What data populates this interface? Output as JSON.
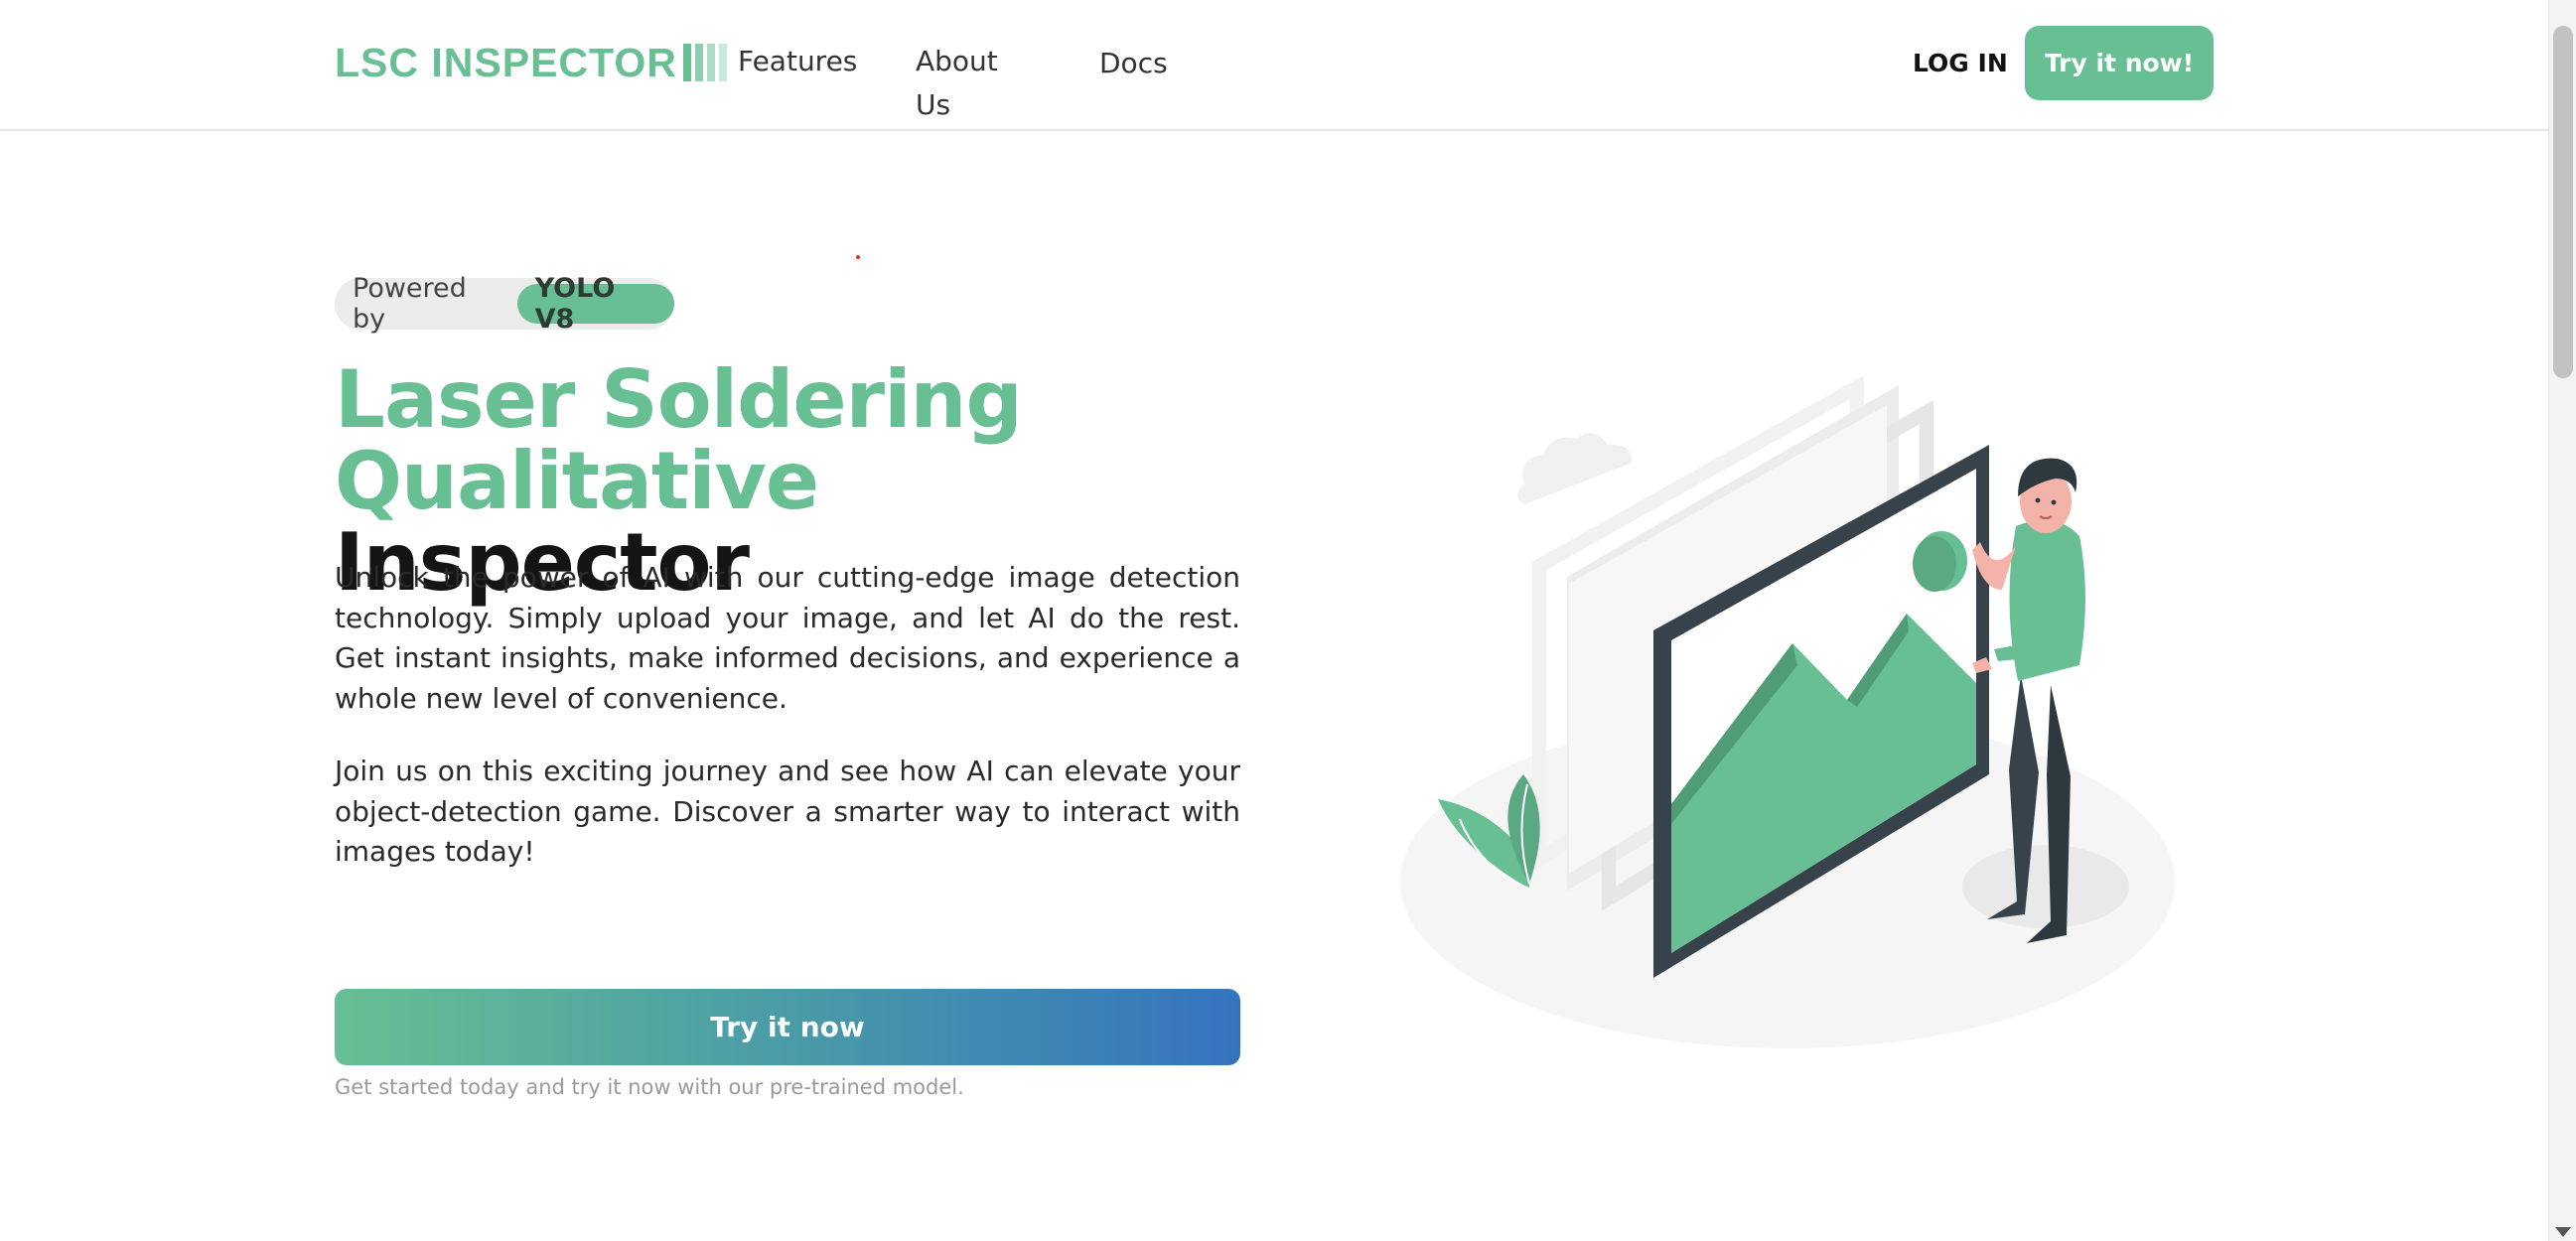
{
  "header": {
    "logo_text": "LSC INSPECTOR",
    "nav": [
      {
        "label": "Features"
      },
      {
        "label": "About Us"
      },
      {
        "label": "Docs"
      }
    ],
    "login_label": "LOG IN",
    "cta_label": "Try it now!"
  },
  "hero": {
    "badge_label": "Powered by",
    "badge_value": "YOLO V8",
    "title_green_line1": "Laser Soldering",
    "title_green_line2": "Qualitative",
    "title_dark": "Inspector",
    "paragraph1": "Unlock the power of AI with our cutting-edge image detection technology. Simply upload your image, and let AI do the rest. Get instant insights, make informed decisions, and experience a whole new level of convenience.",
    "paragraph2": "Join us on this exciting journey and see how AI can elevate your object-detection game. Discover a smarter way to interact with images today!",
    "cta_label": "Try it now",
    "cta_hint": "Get started today and try it now with our pre-trained model."
  },
  "colors": {
    "brand": "#67bf93",
    "gradient_end": "#3474bf",
    "frame_dark": "#37424a"
  },
  "icons": {
    "logo": "barcode-bars-icon",
    "illustration": "person-holding-image-frame"
  }
}
